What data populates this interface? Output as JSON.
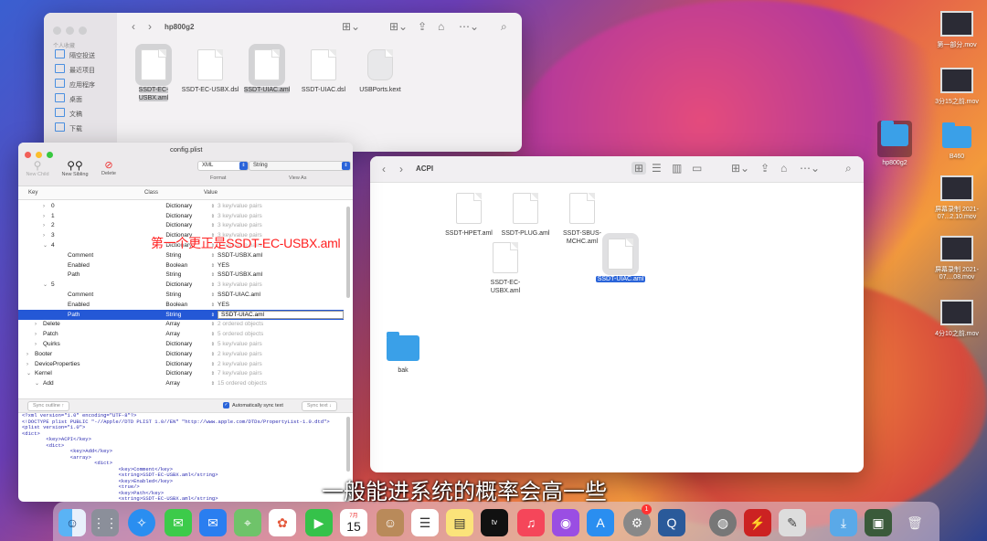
{
  "finder_top": {
    "title": "hp800g2",
    "sidebar_header": "个人收藏",
    "sidebar": [
      "隔空投送",
      "最近项目",
      "应用程序",
      "桌面",
      "文稿",
      "下载"
    ],
    "files": [
      {
        "name": "SSDT-EC-USBX.aml",
        "selected": true
      },
      {
        "name": "SSDT-EC-USBX.dsl",
        "selected": false
      },
      {
        "name": "SSDT-UIAC.aml",
        "selected": true
      },
      {
        "name": "SSDT-UIAC.dsl",
        "selected": false
      },
      {
        "name": "USBPorts.kext",
        "selected": false
      }
    ]
  },
  "finder_acpi": {
    "title": "ACPI",
    "files": [
      {
        "name": "SSDT-HPET.aml"
      },
      {
        "name": "SSDT-PLUG.aml"
      },
      {
        "name": "SSDT-SBUS-MCHC.aml"
      },
      {
        "name": "SSDT-EC-USBX.aml"
      },
      {
        "name": "SSDT-UIAC.aml"
      }
    ],
    "folder": "bak"
  },
  "plist": {
    "title": "config.plist",
    "toolbar": {
      "new_child": "New Child",
      "new_sibling": "New Sibling",
      "delete": "Delete",
      "format_label": "Format",
      "format_value": "XML",
      "viewas_label": "View As",
      "viewas_value": "String"
    },
    "headers": {
      "key": "Key",
      "class": "Class",
      "value": "Value"
    },
    "rows": [
      {
        "key": "0",
        "class": "Dictionary",
        "value": "3 key/value pairs",
        "dim": true
      },
      {
        "key": "1",
        "class": "Dictionary",
        "value": "3 key/value pairs",
        "dim": true
      },
      {
        "key": "2",
        "class": "Dictionary",
        "value": "3 key/value pairs",
        "dim": true
      },
      {
        "key": "3",
        "class": "Dictionary",
        "value": "3 key/value pairs",
        "dim": true
      },
      {
        "key": "4",
        "class": "Dictionary",
        "value": "3 key/value pairs",
        "dim": true
      },
      {
        "key": "Comment",
        "class": "String",
        "value": "SSDT-USBX.aml",
        "dim": false
      },
      {
        "key": "Enabled",
        "class": "Boolean",
        "value": "YES",
        "dim": false
      },
      {
        "key": "Path",
        "class": "String",
        "value": "SSDT-USBX.aml",
        "dim": false
      },
      {
        "key": "5",
        "class": "Dictionary",
        "value": "3 key/value pairs",
        "dim": true
      },
      {
        "key": "Comment",
        "class": "String",
        "value": "SSDT-UIAC.aml",
        "dim": false
      },
      {
        "key": "Enabled",
        "class": "Boolean",
        "value": "YES",
        "dim": false
      },
      {
        "key": "Path",
        "class": "String",
        "value": "SSDT-UIAC.aml",
        "dim": false
      },
      {
        "key": "Delete",
        "class": "Array",
        "value": "2 ordered objects",
        "dim": true
      },
      {
        "key": "Patch",
        "class": "Array",
        "value": "5 ordered objects",
        "dim": true
      },
      {
        "key": "Quirks",
        "class": "Dictionary",
        "value": "5 key/value pairs",
        "dim": true
      },
      {
        "key": "Booter",
        "class": "Dictionary",
        "value": "2 key/value pairs",
        "dim": true
      },
      {
        "key": "DeviceProperties",
        "class": "Dictionary",
        "value": "2 key/value pairs",
        "dim": true
      },
      {
        "key": "Kernel",
        "class": "Dictionary",
        "value": "7 key/value pairs",
        "dim": true
      },
      {
        "key": "Add",
        "class": "Array",
        "value": "15 ordered objects",
        "dim": true
      }
    ],
    "sync_outline": "Sync outline ↑",
    "auto_sync": "Automatically sync text",
    "sync_text": "Sync text ↓",
    "xml_lines": [
      "<?xml version=\"1.0\" encoding=\"UTF-8\"?>",
      "<!DOCTYPE plist PUBLIC \"-//Apple//DTD PLIST 1.0//EN\" \"http://www.apple.com/DTDs/PropertyList-1.0.dtd\">",
      "<plist version=\"1.0\">",
      "<dict>",
      "        <key>ACPI</key>",
      "        <dict>",
      "                <key>Add</key>",
      "                <array>",
      "                        <dict>",
      "                                <key>Comment</key>",
      "                                <string>SSDT-EC-USBX.aml</string>",
      "                                <key>Enabled</key>",
      "                                <true/>",
      "                                <key>Path</key>",
      "                                <string>SSDT-EC-USBX.aml</string>"
    ]
  },
  "annotation": "第一个更正是SSDT-EC-USBX.aml",
  "subtitle": "一般能进系统的概率会高一些",
  "desktop": [
    {
      "name": "第一部分.mov",
      "kind": "video"
    },
    {
      "name": "3分15之前.mov",
      "kind": "video"
    },
    {
      "name": "hp800g2",
      "kind": "folder"
    },
    {
      "name": "B460",
      "kind": "folder"
    },
    {
      "name": "屏幕录制 2021-07...2.10.mov",
      "kind": "video"
    },
    {
      "name": "屏幕录制 2021-07....08.mov",
      "kind": "video"
    },
    {
      "name": "4分10之前.mov",
      "kind": "video"
    }
  ],
  "dock": {
    "calendar_month": "7月",
    "calendar_day": "15",
    "badge": "1"
  }
}
